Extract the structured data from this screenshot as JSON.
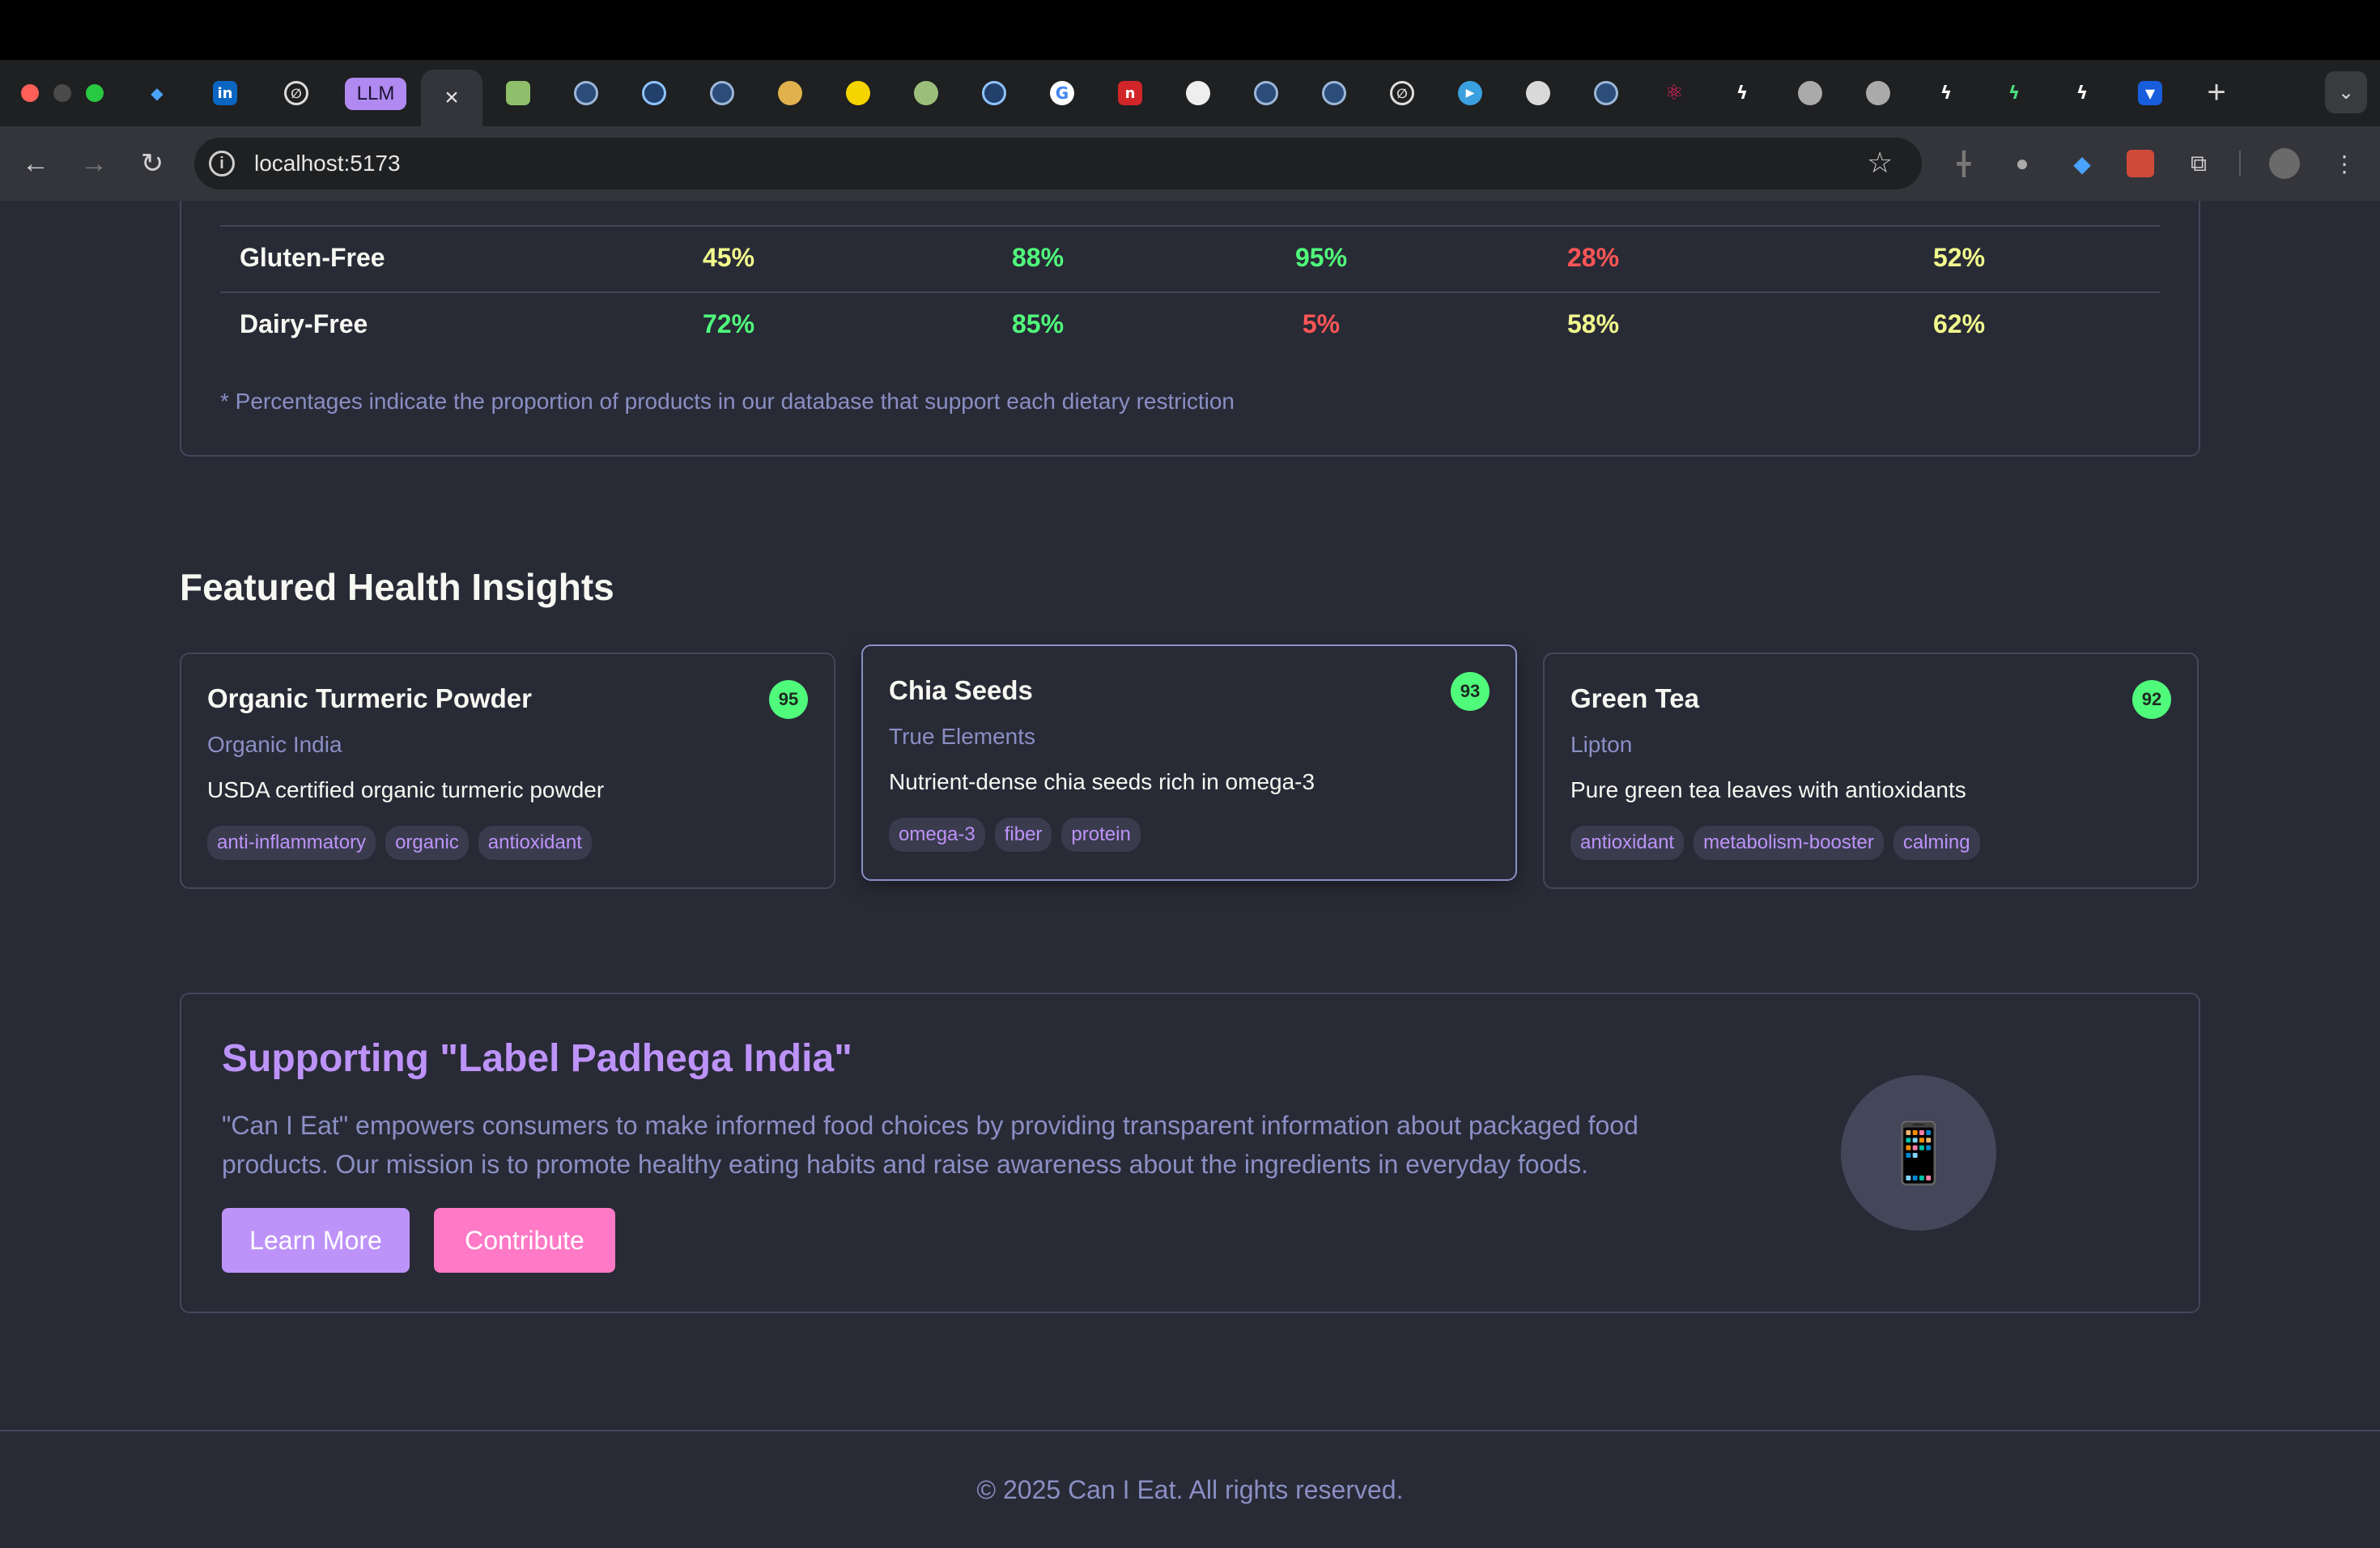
{
  "browser": {
    "url": "localhost:5173",
    "active_tab_close": "×",
    "llm_tab_label": "LLM",
    "tab_favicons": [
      "gem-icon",
      "linkedin-icon",
      "loop-icon",
      "llm-tab",
      "active-tab",
      "image-icon",
      "avatar-icon",
      "wave-icon",
      "avatar-icon",
      "flower-icon",
      "badge-icon",
      "logo-icon",
      "wave-icon",
      "google-icon",
      "n-icon",
      "github-icon",
      "avatar-icon",
      "avatar-icon",
      "loop-icon",
      "play-icon",
      "person-icon",
      "box-icon",
      "react-icon",
      "bolt-icon",
      "globe-icon",
      "globe-icon",
      "bolt-icon",
      "bolt-icon",
      "bolt-icon",
      "bitwarden-icon"
    ]
  },
  "diet_table": {
    "rows": [
      {
        "name": "Gluten-Free",
        "values": [
          "45%",
          "88%",
          "95%",
          "28%",
          "52%"
        ]
      },
      {
        "name": "Dairy-Free",
        "values": [
          "72%",
          "85%",
          "5%",
          "58%",
          "62%"
        ]
      }
    ],
    "footnote": "* Percentages indicate the proportion of products in our database that support each dietary restriction",
    "colors": {
      "high": "#50fa7b",
      "mid": "#f1fa8c",
      "low": "#ff5555"
    }
  },
  "insights": {
    "title": "Featured Health Insights",
    "products": [
      {
        "name": "Organic Turmeric Powder",
        "brand": "Organic India",
        "desc": "USDA certified organic turmeric powder",
        "score": "95",
        "tags": [
          "anti-inflammatory",
          "organic",
          "antioxidant"
        ]
      },
      {
        "name": "Chia Seeds",
        "brand": "True Elements",
        "desc": "Nutrient-dense chia seeds rich in omega-3",
        "score": "93",
        "tags": [
          "omega-3",
          "fiber",
          "protein"
        ]
      },
      {
        "name": "Green Tea",
        "brand": "Lipton",
        "desc": "Pure green tea leaves with antioxidants",
        "score": "92",
        "tags": [
          "antioxidant",
          "metabolism-booster",
          "calming"
        ]
      }
    ]
  },
  "mission": {
    "title": "Supporting \"Label Padhega India\"",
    "text": "\"Can I Eat\" empowers consumers to make informed food choices by providing transparent information about packaged food products. Our mission is to promote healthy eating habits and raise awareness about the ingredients in everyday foods.",
    "learn_more": "Learn More",
    "contribute": "Contribute",
    "icon": "📱"
  },
  "footer": {
    "text": "© 2025 Can I Eat. All rights reserved."
  }
}
